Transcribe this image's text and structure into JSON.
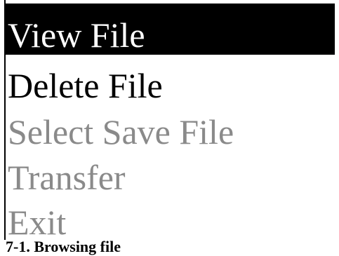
{
  "menu": {
    "items": [
      {
        "label": "View File",
        "state": "selected"
      },
      {
        "label": "Delete File",
        "state": "enabled"
      },
      {
        "label": "Select Save File",
        "state": "disabled"
      },
      {
        "label": "Transfer",
        "state": "disabled"
      },
      {
        "label": "Exit",
        "state": "disabled"
      }
    ]
  },
  "caption": {
    "text": "7-1. Browsing file"
  },
  "colors": {
    "selected_background": "#000000",
    "selected_text": "#ffffff",
    "enabled_text": "#000000",
    "disabled_text": "#8a8a8a"
  }
}
